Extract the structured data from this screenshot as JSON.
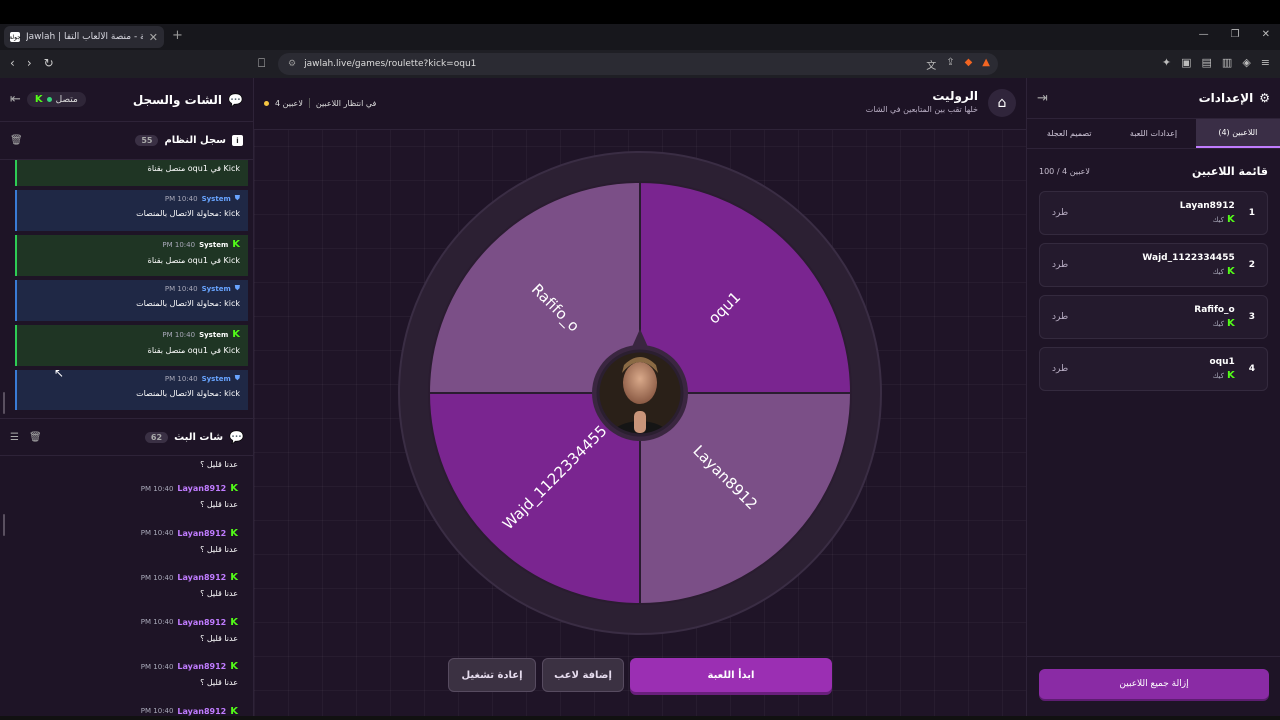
{
  "browser": {
    "tab_title": "Jawlah | جولة - منصة الألعاب التفا",
    "tab_favicon": "جولة",
    "url": "jawlah.live/games/roulette?kick=oqu1"
  },
  "left_panel": {
    "title": "الشات والسجل",
    "status": "متصل",
    "log_title": "سجل النظام",
    "log_count": "55",
    "log_items": [
      {
        "type": "kick",
        "name": "",
        "time": "",
        "text": "متصل بقناة oqu1 في Kick"
      },
      {
        "type": "system",
        "name": "System",
        "time": "PM 10:40",
        "text": "محاولة الاتصال بالمنصات: kick"
      },
      {
        "type": "kick",
        "name": "System",
        "time": "PM 10:40",
        "text": "متصل بقناة oqu1 في Kick"
      },
      {
        "type": "system",
        "name": "System",
        "time": "PM 10:40",
        "text": "محاولة الاتصال بالمنصات: kick"
      },
      {
        "type": "kick",
        "name": "System",
        "time": "PM 10:40",
        "text": "متصل بقناة oqu1 في Kick"
      },
      {
        "type": "system",
        "name": "System",
        "time": "PM 10:40",
        "text": "محاولة الاتصال بالمنصات: kick"
      }
    ],
    "chat_title": "شات البث",
    "chat_count": "62",
    "first_msg": "عدنا قليل ؟",
    "messages": [
      {
        "user": "Layan8912",
        "time": "PM 10:40",
        "text": "عدنا قليل ؟"
      },
      {
        "user": "Layan8912",
        "time": "PM 10:40",
        "text": "عدنا قليل ؟"
      },
      {
        "user": "Layan8912",
        "time": "PM 10:40",
        "text": "عدنا قليل ؟"
      },
      {
        "user": "Layan8912",
        "time": "PM 10:40",
        "text": "عدنا قليل ؟"
      },
      {
        "user": "Layan8912",
        "time": "PM 10:40",
        "text": "عدنا قليل ؟"
      },
      {
        "user": "Layan8912",
        "time": "PM 10:40",
        "text": "عدنا قليل ؟"
      }
    ]
  },
  "center": {
    "title": "الروليت",
    "subtitle": "خلها تقب بين المتابعين في الشات",
    "players_count": "4 لاعبين",
    "waiting": "في انتظار اللاعبين",
    "wheel": {
      "segments": [
        {
          "label": "oqu1",
          "color": "#7a2590"
        },
        {
          "label": "Layan8912",
          "color": "#7b4f87"
        },
        {
          "label": "Wajd_1122334455",
          "color": "#7a2590"
        },
        {
          "label": "Rafifo_o",
          "color": "#7b4f87"
        }
      ],
      "rim_color": "#2c2033"
    },
    "start_button": "ابدأ اللعبة",
    "add_button": "إضافة لاعب",
    "reset_button": "إعادة تشغيل"
  },
  "right_panel": {
    "title": "الإعدادات",
    "tabs": [
      "اللاعبين (4)",
      "إعدادات اللعبة",
      "تصميم العجلة"
    ],
    "list_title": "قائمة اللاعبين",
    "list_count": "100 / 4 لاعبين",
    "kick_label": "طرد",
    "platform": "كيك",
    "players": [
      {
        "num": "1",
        "name": "Layan8912"
      },
      {
        "num": "2",
        "name": "Wajd_1122334455"
      },
      {
        "num": "3",
        "name": "Rafifo_o"
      },
      {
        "num": "4",
        "name": "oqu1"
      }
    ],
    "remove_all": "إزالة جميع اللاعبين"
  }
}
